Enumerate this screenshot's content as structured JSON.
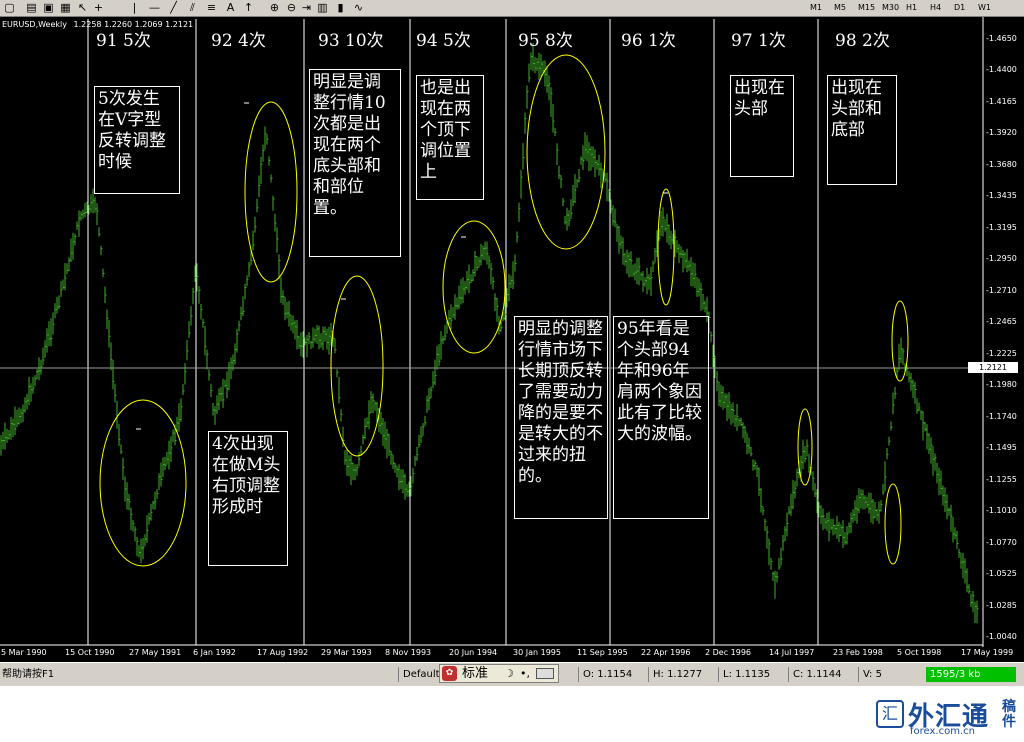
{
  "toolbar": {
    "icons": [
      "new-file-icon",
      "open-icon",
      "save-icon",
      "print-icon",
      "cursor-icon",
      "crosshair-icon",
      "vertical-line-icon",
      "horizontal-line-icon",
      "trendline-icon",
      "channel-icon",
      "fibonacci-icon",
      "text-icon",
      "arrow-icon",
      "zoom-in-icon",
      "zoom-out-icon",
      "scroll-icon",
      "bar-chart-icon",
      "candle-icon",
      "line-chart-icon"
    ],
    "timeframes": [
      "M1",
      "M5",
      "M15",
      "M30",
      "H1",
      "H4",
      "D1",
      "W1"
    ]
  },
  "chart": {
    "symbol": "EURUSD,Weekly",
    "ohlc": "1.2258 1.2260 1.2069 1.2121",
    "current_price": "1.2121",
    "y_ticks": [
      "1.4650",
      "1.4400",
      "1.4165",
      "1.3920",
      "1.3680",
      "1.3435",
      "1.3195",
      "1.2950",
      "1.2710",
      "1.2465",
      "1.2225",
      "1.1980",
      "1.1740",
      "1.1495",
      "1.1255",
      "1.1010",
      "1.0770",
      "1.0525",
      "1.0285",
      "1.0040"
    ],
    "x_ticks": [
      "5 Mar 1990",
      "15 Oct 1990",
      "27 May 1991",
      "6 Jan 1992",
      "17 Aug 1992",
      "29 Mar 1993",
      "8 Nov 1993",
      "20 Jun 1994",
      "30 Jan 1995",
      "11 Sep 1995",
      "22 Apr 1996",
      "2 Dec 1996",
      "14 Jul 1997",
      "23 Feb 1998",
      "5 Oct 1998",
      "17 May 1999"
    ],
    "colors": {
      "background": "#000000",
      "bars": "#3fae2a",
      "ellipse": "#ffff00",
      "grid": "#ffffff"
    },
    "year_labels": [
      "91 5次",
      "92 4次",
      "93 10次",
      "94 5次",
      "95 8次",
      "96 1次",
      "97 1次",
      "98 2次"
    ],
    "notes": [
      "5次发生在V字型反转调整时候",
      "明显是调整行情10次都是出现在两个底头部和和部位置。",
      "也是出现在两个顶下调位置上",
      "出现在头部",
      "出现在头部和底部",
      "4次出现在做M头右顶调整形成时",
      "明显的调整行情市场下长期顶反转了需要动力降的是要不是转大的不过来的扭的。",
      "95年看是个头部94年和96年肩两个象因此有了比较大的波幅。"
    ]
  },
  "status": {
    "help": "帮助请按F1",
    "profile": "Default",
    "ime_label": "标准",
    "open": "O: 1.1154",
    "high": "H: 1.1277",
    "low": "L: 1.1135",
    "close": "C: 1.1144",
    "volume": "V: 5",
    "traffic": "1595/3 kb"
  },
  "watermark": {
    "brand": "外汇通",
    "url": "forex.com.cn",
    "side": "稿件"
  }
}
